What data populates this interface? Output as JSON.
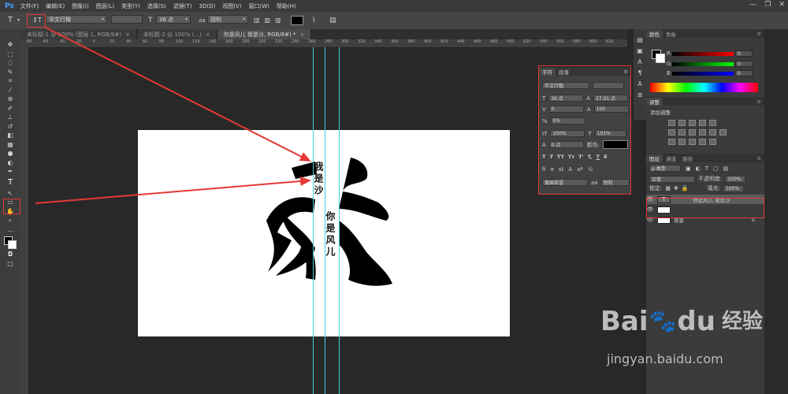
{
  "menubar": {
    "logo": "Ps",
    "items": [
      "文件(F)",
      "编辑(E)",
      "图像(I)",
      "图层(L)",
      "类型(Y)",
      "选择(S)",
      "滤镜(T)",
      "3D(D)",
      "视图(V)",
      "窗口(W)",
      "帮助(H)"
    ],
    "window_controls": [
      "—",
      "❐",
      "✕"
    ]
  },
  "options": {
    "tool_icon": "T",
    "font_family": "华文行楷",
    "font_style": "",
    "size_icon": "T",
    "font_size": "36 点",
    "aa_icon": "aa",
    "antialias": "锐利",
    "text_color": "#000000"
  },
  "tabs": [
    {
      "label": "未标题-1 @ 100% (图层 1, RGB/8#)",
      "close": "×",
      "active": false
    },
    {
      "label": "未标题-2 @ 100% (...)",
      "close": "×",
      "active": false
    },
    {
      "label": "你是风儿 我是沙, RGB/8#) *",
      "close": "×",
      "active": true
    }
  ],
  "ruler_labels": [
    "80",
    "60",
    "40",
    "20",
    "0",
    "20",
    "40",
    "60",
    "80",
    "100",
    "120",
    "140",
    "160",
    "180",
    "200",
    "220",
    "240",
    "260",
    "280",
    "300",
    "320",
    "340",
    "360",
    "380",
    "400",
    "420",
    "440",
    "460",
    "480",
    "500",
    "520",
    "540",
    "560",
    "580",
    "600",
    "620"
  ],
  "canvas": {
    "text_col1": "我是沙",
    "text_col2": "你是风儿"
  },
  "character_panel": {
    "tabs": [
      "字符",
      "段落"
    ],
    "font_family": "华文行楷",
    "font_style": "",
    "size": "36 点",
    "leading": "27.01 点",
    "tracking_kern": "0",
    "tracking": "100",
    "scale_pct": "0%",
    "v_scale": "100%",
    "h_scale": "101%",
    "baseline": "0 点",
    "color_label": "颜色:",
    "color": "#000000",
    "style_buttons": [
      "T",
      "T",
      "TT",
      "Tт",
      "T'",
      "T,",
      "T",
      "T"
    ],
    "language": "美国英语",
    "aa": "锐利"
  },
  "color_panel": {
    "tabs": [
      "颜色",
      "色板"
    ],
    "channels": [
      {
        "label": "R",
        "value": "0"
      },
      {
        "label": "G",
        "value": "0"
      },
      {
        "label": "B",
        "value": "0"
      }
    ]
  },
  "adjust_panel": {
    "tabs": [
      "调整"
    ],
    "title": "添加调整"
  },
  "layers_panel": {
    "tabs": [
      "图层",
      "通道",
      "路径"
    ],
    "filter": "ρ 类型",
    "blend_mode": "正常",
    "opacity_label": "不透明度:",
    "opacity": "100%",
    "lock_label": "锁定:",
    "fill_label": "填充:",
    "fill": "100%",
    "layers": [
      {
        "name": "你是风儿 我是沙",
        "thumb": "T",
        "selected": true
      },
      {
        "name": "",
        "thumb": "",
        "selected": false
      },
      {
        "name": "背景",
        "thumb": "",
        "selected": false,
        "locked": true
      }
    ]
  },
  "watermark": {
    "brand": "Bai",
    "brand2": "du",
    "suffix": "经验",
    "url": "jingyan.baidu.com"
  },
  "colors": {
    "accent_blue": "#3fa8ff",
    "annotation_red": "#e53935",
    "guide_cyan": "#3cd3de"
  }
}
